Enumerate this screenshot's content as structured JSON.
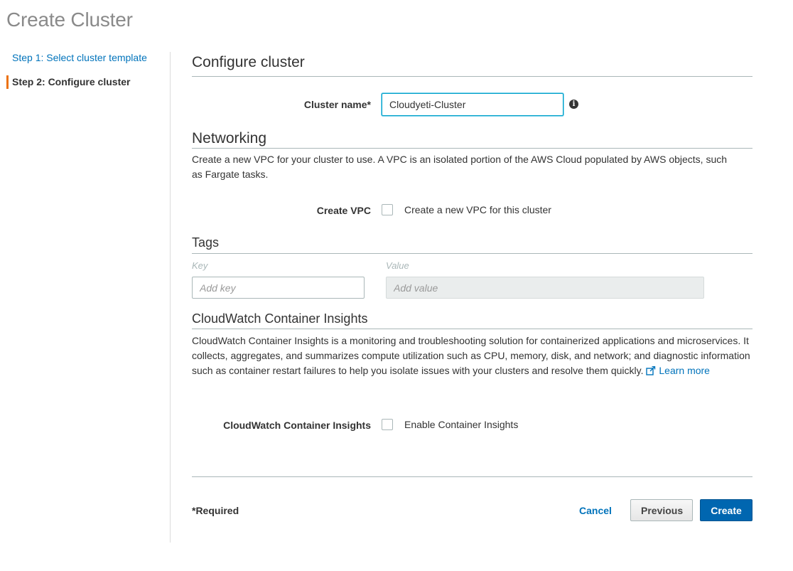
{
  "page": {
    "title": "Create Cluster"
  },
  "steps": [
    {
      "label": "Step 1: Select cluster template"
    },
    {
      "label": "Step 2: Configure cluster"
    }
  ],
  "configure": {
    "title": "Configure cluster",
    "cluster_name_label": "Cluster name*",
    "cluster_name_value": "Cloudyeti-Cluster",
    "info_icon": "info-icon"
  },
  "networking": {
    "title": "Networking",
    "description": "Create a new VPC for your cluster to use. A VPC is an isolated portion of the AWS Cloud populated by AWS objects, such as Fargate tasks.",
    "create_vpc_label": "Create VPC",
    "create_vpc_checkbox_text": "Create a new VPC for this cluster",
    "create_vpc_checked": false
  },
  "tags": {
    "title": "Tags",
    "key_header": "Key",
    "value_header": "Value",
    "key_placeholder": "Add key",
    "value_placeholder": "Add value"
  },
  "insights": {
    "title": "CloudWatch Container Insights",
    "description": "CloudWatch Container Insights is a monitoring and troubleshooting solution for containerized applications and microservices. It collects, aggregates, and summarizes compute utilization such as CPU, memory, disk, and network; and diagnostic information such as container restart failures to help you isolate issues with your clusters and resolve them quickly.",
    "learn_more": "Learn more",
    "field_label": "CloudWatch Container Insights",
    "checkbox_text": "Enable Container Insights",
    "checked": false
  },
  "footer": {
    "required_note": "*Required",
    "cancel": "Cancel",
    "previous": "Previous",
    "create": "Create"
  },
  "colors": {
    "link": "#0073bb",
    "active_step_marker": "#ec7211",
    "primary_button": "#0066b0"
  }
}
